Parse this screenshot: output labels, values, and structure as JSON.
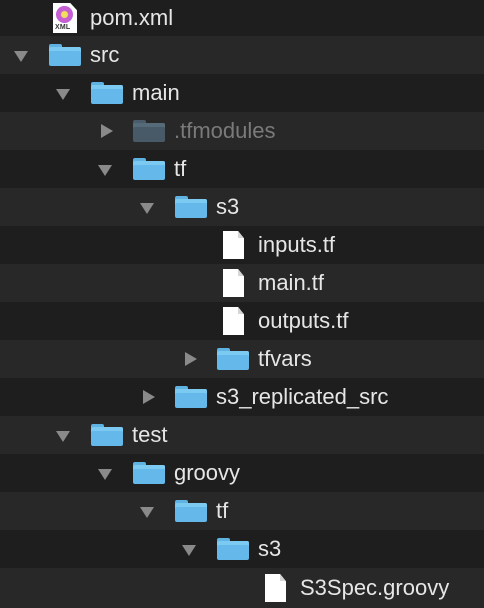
{
  "tree": {
    "pom": {
      "name": "pom.xml",
      "icon": "xml-file-icon",
      "badge": "XML"
    },
    "src": {
      "name": "src",
      "icon": "folder-icon",
      "expanded": true
    },
    "main": {
      "name": "main",
      "icon": "folder-icon",
      "expanded": true
    },
    "tfmodules": {
      "name": ".tfmodules",
      "icon": "folder-icon",
      "expanded": false,
      "hidden": true
    },
    "tf": {
      "name": "tf",
      "icon": "folder-icon",
      "expanded": true
    },
    "s3": {
      "name": "s3",
      "icon": "folder-icon",
      "expanded": true
    },
    "inputs": {
      "name": "inputs.tf",
      "icon": "document-icon"
    },
    "maintf": {
      "name": "main.tf",
      "icon": "document-icon"
    },
    "outputs": {
      "name": "outputs.tf",
      "icon": "document-icon"
    },
    "tfvars": {
      "name": "tfvars",
      "icon": "folder-icon",
      "expanded": false
    },
    "s3_replicated_src": {
      "name": "s3_replicated_src",
      "icon": "folder-icon",
      "expanded": false
    },
    "test": {
      "name": "test",
      "icon": "folder-icon",
      "expanded": true
    },
    "groovy": {
      "name": "groovy",
      "icon": "folder-icon",
      "expanded": true
    },
    "test_tf": {
      "name": "tf",
      "icon": "folder-icon",
      "expanded": true
    },
    "test_s3": {
      "name": "s3",
      "icon": "folder-icon",
      "expanded": true
    },
    "s3spec": {
      "name": "S3Spec.groovy",
      "icon": "document-icon"
    }
  },
  "colors": {
    "background": "#1e1e1e",
    "stripe": "#282828",
    "folder": "#65b9ea",
    "text": "#e6e6e6",
    "dim_text": "#7a7a7a",
    "disclosure": "#8a8a8a"
  }
}
